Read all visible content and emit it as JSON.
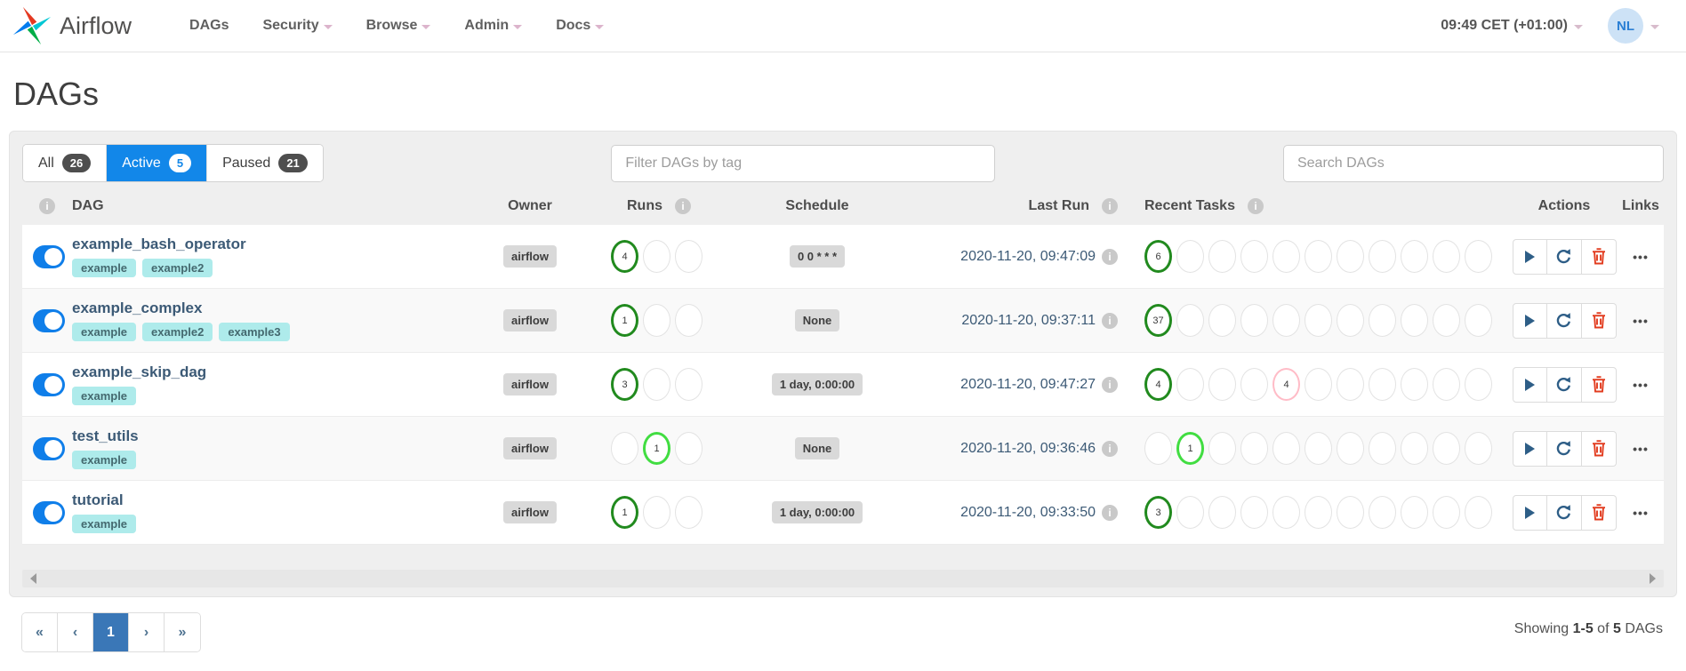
{
  "navbar": {
    "brand": "Airflow",
    "items": [
      {
        "label": "DAGs",
        "caret": false
      },
      {
        "label": "Security",
        "caret": true
      },
      {
        "label": "Browse",
        "caret": true
      },
      {
        "label": "Admin",
        "caret": true
      },
      {
        "label": "Docs",
        "caret": true
      }
    ],
    "clock": "09:49 CET (+01:00)",
    "avatar_initials": "NL"
  },
  "page_title": "DAGs",
  "tabs": [
    {
      "label": "All",
      "count": "26",
      "active": false
    },
    {
      "label": "Active",
      "count": "5",
      "active": true
    },
    {
      "label": "Paused",
      "count": "21",
      "active": false
    }
  ],
  "filters": {
    "tag_placeholder": "Filter DAGs by tag",
    "search_placeholder": "Search DAGs"
  },
  "table": {
    "headers": {
      "dag": "DAG",
      "owner": "Owner",
      "runs": "Runs",
      "schedule": "Schedule",
      "last_run": "Last Run",
      "recent_tasks": "Recent Tasks",
      "actions": "Actions",
      "links": "Links"
    },
    "info_glyph": "i",
    "rows": [
      {
        "name": "example_bash_operator",
        "tags": [
          "example",
          "example2"
        ],
        "owner": "airflow",
        "runs": [
          "success:4",
          "empty",
          "empty"
        ],
        "schedule": "0 0 * * *",
        "last_run": "2020-11-20, 09:47:09",
        "recent_tasks": [
          "success:6",
          "empty",
          "empty",
          "empty",
          "empty",
          "empty",
          "empty",
          "empty",
          "empty",
          "empty",
          "empty"
        ]
      },
      {
        "name": "example_complex",
        "tags": [
          "example",
          "example2",
          "example3"
        ],
        "owner": "airflow",
        "runs": [
          "success:1",
          "empty",
          "empty"
        ],
        "schedule": "None",
        "last_run": "2020-11-20, 09:37:11",
        "recent_tasks": [
          "success:37",
          "empty",
          "empty",
          "empty",
          "empty",
          "empty",
          "empty",
          "empty",
          "empty",
          "empty",
          "empty"
        ]
      },
      {
        "name": "example_skip_dag",
        "tags": [
          "example"
        ],
        "owner": "airflow",
        "runs": [
          "success:3",
          "empty",
          "empty"
        ],
        "schedule": "1 day, 0:00:00",
        "last_run": "2020-11-20, 09:47:27",
        "recent_tasks": [
          "success:4",
          "empty",
          "empty",
          "empty",
          "skipped:4",
          "empty",
          "empty",
          "empty",
          "empty",
          "empty",
          "empty"
        ]
      },
      {
        "name": "test_utils",
        "tags": [
          "example"
        ],
        "owner": "airflow",
        "runs": [
          "empty",
          "running:1",
          "empty"
        ],
        "schedule": "None",
        "last_run": "2020-11-20, 09:36:46",
        "recent_tasks": [
          "empty",
          "running:1",
          "empty",
          "empty",
          "empty",
          "empty",
          "empty",
          "empty",
          "empty",
          "empty",
          "empty"
        ]
      },
      {
        "name": "tutorial",
        "tags": [
          "example"
        ],
        "owner": "airflow",
        "runs": [
          "success:1",
          "empty",
          "empty"
        ],
        "schedule": "1 day, 0:00:00",
        "last_run": "2020-11-20, 09:33:50",
        "recent_tasks": [
          "success:3",
          "empty",
          "empty",
          "empty",
          "empty",
          "empty",
          "empty",
          "empty",
          "empty",
          "empty",
          "empty"
        ]
      }
    ],
    "links_glyph": "•••"
  },
  "icons": [
    "pinwheel-logo",
    "info-icon",
    "play-icon",
    "refresh-icon",
    "trash-icon",
    "ellipsis-icon",
    "caret-down-icon",
    "scroll-left-icon",
    "scroll-right-icon"
  ],
  "colors": {
    "accent_blue": "#1287e9",
    "toggle_blue": "#0f7ee9",
    "pagination_blue": "#3a77b7",
    "success_green": "#218a1e",
    "running_lime": "#41dd41",
    "skipped_pink": "#ffbcc7",
    "delete_red": "#e23c1f",
    "action_navy": "#2e5e87",
    "tag_cyan": "#aeebeb"
  },
  "pagination": {
    "first": "«",
    "prev": "‹",
    "page": "1",
    "next": "›",
    "last": "»"
  },
  "summary": {
    "prefix": "Showing",
    "range": "1-5",
    "middle": "of",
    "total": "5",
    "suffix": "DAGs"
  }
}
